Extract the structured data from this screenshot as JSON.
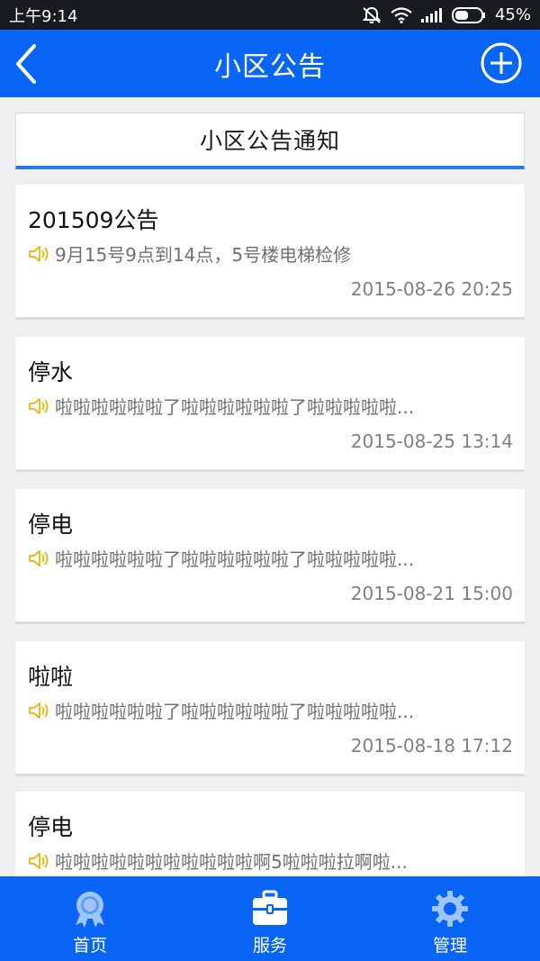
{
  "status_bar": {
    "time": "上午9:14",
    "battery": "45%"
  },
  "header": {
    "title": "小区公告"
  },
  "section": {
    "title": "小区公告通知"
  },
  "notices": [
    {
      "title": "201509公告",
      "body": "9月15号9点到14点，5号楼电梯检修",
      "date": "2015-08-26 20:25"
    },
    {
      "title": "停水",
      "body": "啦啦啦啦啦啦了啦啦啦啦啦啦了啦啦啦啦啦...",
      "date": "2015-08-25 13:14"
    },
    {
      "title": "停电",
      "body": "啦啦啦啦啦啦了啦啦啦啦啦啦了啦啦啦啦啦...",
      "date": "2015-08-21 15:00"
    },
    {
      "title": "啦啦",
      "body": "啦啦啦啦啦啦了啦啦啦啦啦啦了啦啦啦啦啦...",
      "date": "2015-08-18 17:12"
    },
    {
      "title": "停电",
      "body": "啦啦啦啦啦啦啦啦啦啦啦啊5啦啦啦拉啊啦...",
      "date": ""
    }
  ],
  "tabs": [
    {
      "label": "首页",
      "icon": "medal-icon"
    },
    {
      "label": "服务",
      "icon": "briefcase-icon"
    },
    {
      "label": "管理",
      "icon": "gear-icon"
    }
  ],
  "colors": {
    "primary": "#0865f5",
    "accent_underline": "#2b78e4",
    "speaker": "#f0b400"
  }
}
